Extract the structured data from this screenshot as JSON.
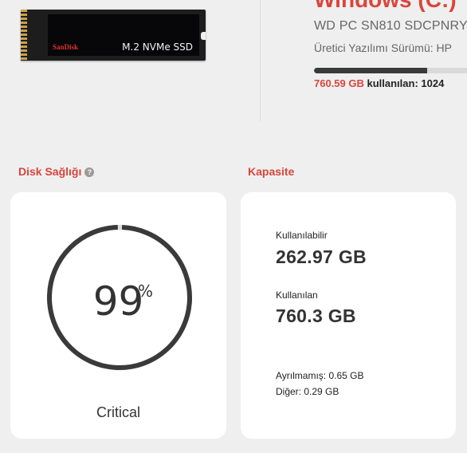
{
  "drive": {
    "title": "Windows (C:)",
    "model": "WD PC SN810 SDCPNRY",
    "firmware": "Üretici Yazılımı Sürümü: HP",
    "usage_used": "760.59 GB",
    "usage_rest": " kullanılan: 1024",
    "used_fraction": 0.74
  },
  "ssd_image": {
    "brand": "SanDisk",
    "type": "M.2 NVMe SSD"
  },
  "health": {
    "title": "Disk Sağlığı",
    "help_icon": "question-circle-icon",
    "value": "99",
    "percent_sign": "%",
    "fraction": 0.99,
    "status": "Critical"
  },
  "capacity": {
    "title": "Kapasite",
    "available_label": "Kullanılabilir",
    "available_value": "262.97 GB",
    "used_label": "Kullanılan",
    "used_value": "760.3 GB",
    "reserved": "Ayrılmamış: 0.65 GB",
    "other": "Diğer: 0.29 GB"
  },
  "colors": {
    "accent": "#d9453b",
    "gauge_ring": "#3a3a3a",
    "gauge_gap": "#dcdcdc"
  }
}
